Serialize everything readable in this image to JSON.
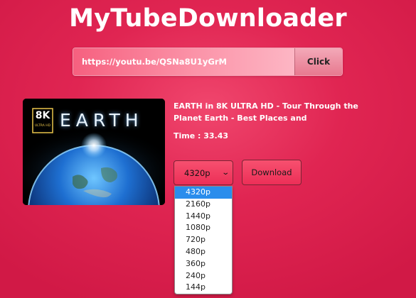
{
  "app": {
    "title": "MyTubeDownloader"
  },
  "url_bar": {
    "value": "https://youtu.be/QSNa8U1yGrM",
    "button_label": "Click"
  },
  "video": {
    "thumbnail": {
      "badge": "8K",
      "badge_sub": "ULTRA HD",
      "word": "EARTH"
    },
    "title": "EARTH in 8K ULTRA HD - Tour Through the Planet Earth - Best Places and",
    "time": "Time : 33.43"
  },
  "quality": {
    "selected": "4320p",
    "options": [
      "4320p",
      "2160p",
      "1440p",
      "1080p",
      "720p",
      "480p",
      "360p",
      "240p",
      "144p"
    ]
  },
  "download": {
    "label": "Download"
  },
  "colors": {
    "background": "#e02552",
    "accent": "#f7506f",
    "dropdown_highlight": "#2a8dec"
  }
}
